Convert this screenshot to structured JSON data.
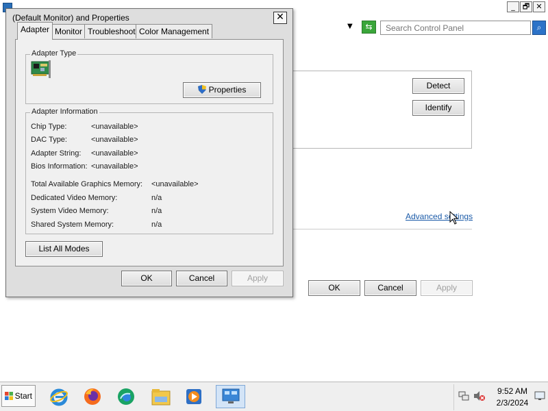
{
  "dialog": {
    "title": "(Default Monitor) and  Properties",
    "close_label": "✕",
    "tabs": [
      {
        "label": "Adapter"
      },
      {
        "label": "Monitor"
      },
      {
        "label": "Troubleshoot"
      },
      {
        "label": "Color Management"
      }
    ],
    "adapter_type": {
      "group_label": "Adapter Type",
      "properties_label": "Properties"
    },
    "adapter_info": {
      "group_label": "Adapter Information",
      "rows": [
        {
          "label": "Chip Type:",
          "value": "<unavailable>"
        },
        {
          "label": "DAC Type:",
          "value": "<unavailable>"
        },
        {
          "label": "Adapter String:",
          "value": "<unavailable>"
        },
        {
          "label": "Bios Information:",
          "value": "<unavailable>"
        }
      ],
      "memory_rows": [
        {
          "label": "Total Available Graphics Memory:",
          "value": "<unavailable>"
        },
        {
          "label": "Dedicated Video Memory:",
          "value": "n/a"
        },
        {
          "label": "System Video Memory:",
          "value": "n/a"
        },
        {
          "label": "Shared System Memory:",
          "value": "n/a"
        }
      ]
    },
    "list_all_modes_label": "List All Modes",
    "ok_label": "OK",
    "cancel_label": "Cancel",
    "apply_label": "Apply"
  },
  "background": {
    "window_controls": {
      "minimize": "_",
      "restore": "🗗",
      "close": "✕"
    },
    "search": {
      "placeholder": "Search Control Panel"
    },
    "detect_label": "Detect",
    "identify_label": "Identify",
    "advanced_settings_label": "Advanced settings",
    "ok_label": "OK",
    "cancel_label": "Cancel",
    "apply_label": "Apply"
  },
  "taskbar": {
    "start_label": "Start",
    "clock": {
      "time": "9:52 AM",
      "date": "2/3/2024"
    }
  },
  "colors": {
    "accent": "#2c73c8",
    "link": "#1a5aa8",
    "dialog_bg": "#f0f0f0"
  }
}
